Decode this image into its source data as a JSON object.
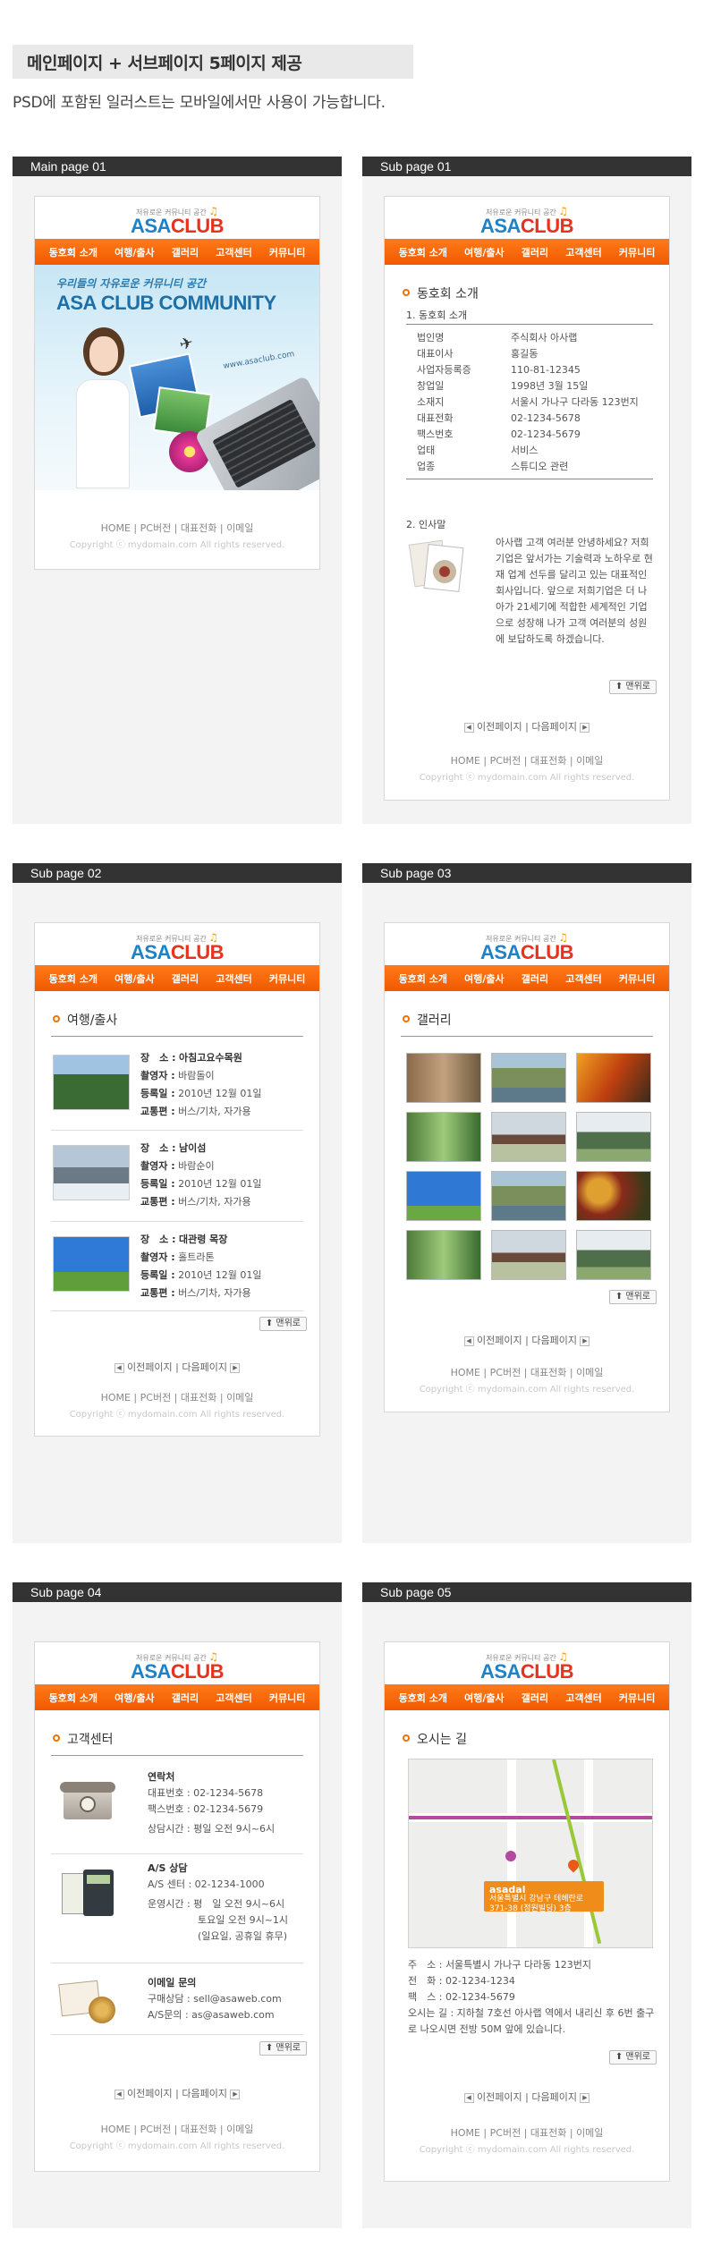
{
  "header": {
    "title": "메인페이지 + 서브페이지 5페이지 제공",
    "subtitle": "PSD에 포함된 일러스트는 모바일에서만 사용이 가능합니다."
  },
  "logo": {
    "tagline": "저유로운 커뮤니티 공간",
    "asa": "ASA",
    "club": "CLUB"
  },
  "nav": [
    "동호회 소개",
    "여행/출사",
    "갤러리",
    "고객센터",
    "커뮤니티"
  ],
  "footer": {
    "links": "HOME | PC버전 | 대표전화 | 이메일",
    "copyright": "Copyright ⓒ mydomain.com All rights reserved."
  },
  "pager": {
    "prev": "이전페이지",
    "sep": "|",
    "next": "다음페이지",
    "prev_icon": "◀",
    "next_icon": "▶"
  },
  "top_button": "⬆ 맨위로",
  "colors": {
    "accent": "#f05a00",
    "logo_blue": "#1e82c8",
    "logo_red": "#e8321e",
    "column_bar": "#333333"
  },
  "pages": {
    "main": {
      "label": "Main page 01",
      "banner": {
        "headline_small": "우리들의 자유로운 커뮤니티 공간",
        "headline": "ASA CLUB COMMUNITY",
        "url": "www.asaclub.com"
      }
    },
    "sub01": {
      "label": "Sub page 01",
      "title": "동호회 소개",
      "section1": "1. 동호회 소개",
      "info": [
        {
          "k": "법인명",
          "v": "주식회사 아사랩"
        },
        {
          "k": "대표이사",
          "v": "홍길동"
        },
        {
          "k": "사업자등록증",
          "v": "110-81-12345"
        },
        {
          "k": "창업일",
          "v": "1998년 3월 15일"
        },
        {
          "k": "소재지",
          "v": "서울시 가나구 다라동 123번지"
        },
        {
          "k": "대표전화",
          "v": "02-1234-5678"
        },
        {
          "k": "팩스번호",
          "v": "02-1234-5679"
        },
        {
          "k": "업태",
          "v": "서비스"
        },
        {
          "k": "업종",
          "v": "스튜디오 관련"
        }
      ],
      "section2": "2. 인사말",
      "greeting": "아사랩 고객 여러분 안녕하세요? 저희 기업은 앞서가는 기술력과 노하우로 현재 업계 선두를 달리고 있는 대표적인 회사입니다. 앞으로 저희기업은 더 나아가 21세기에 적합한 세계적인 기업으로 성장해 나가 고객 여러분의 성원에 보답하도록 하겠습니다."
    },
    "sub02": {
      "label": "Sub page 02",
      "title": "여행/출사",
      "labels": {
        "place": "장　소 :",
        "author": "촬영자 :",
        "date": "등록일 :",
        "transport": "교통편 :"
      },
      "entries": [
        {
          "place": "아침고요수목원",
          "author": "바람돌이",
          "date": "2010년 12월 01일",
          "transport": "버스/기차, 자가용"
        },
        {
          "place": "남이섬",
          "author": "바람순이",
          "date": "2010년 12월 01일",
          "transport": "버스/기차, 자가용"
        },
        {
          "place": "대관령 목장",
          "author": "홀트라톤",
          "date": "2010년 12월 01일",
          "transport": "버스/기차, 자가용"
        }
      ]
    },
    "sub03": {
      "label": "Sub page 03",
      "title": "갤러리"
    },
    "sub04": {
      "label": "Sub page 04",
      "title": "고객센터",
      "contact": {
        "title": "연락처",
        "lines": [
          "대표번호 : 02-1234-5678",
          "팩스번호 : 02-1234-5679",
          "상담시간 : 평일 오전 9시~6시"
        ]
      },
      "as": {
        "title": "A/S 상담",
        "lines": [
          "A/S 센터 : 02-1234-1000",
          "운영시간 : 평　일 오전 9시~6시",
          "토요일 오전 9시~1시",
          "(일요일, 공휴일 휴무)"
        ]
      },
      "email": {
        "title": "이메일 문의",
        "lines": [
          "구매상담 : sell@asaweb.com",
          "A/S문의 : as@asaweb.com"
        ]
      }
    },
    "sub05": {
      "label": "Sub page 05",
      "title": "오시는 길",
      "map_label": "asadal",
      "map_note": "서울특별시 강남구 테헤란로 371-38 (정원빌딩) 3층",
      "lines": [
        "주　소 : 서울특별시 가나구 다라동 123번지",
        "전　화 : 02-1234-1234",
        "팩　스 : 02-1234-5679",
        "오시는 길 : 지하철 7호선 아사랩 역에서 내리신 후 6번 출구로 나오시면 전방 50M 앞에 있습니다."
      ]
    }
  }
}
